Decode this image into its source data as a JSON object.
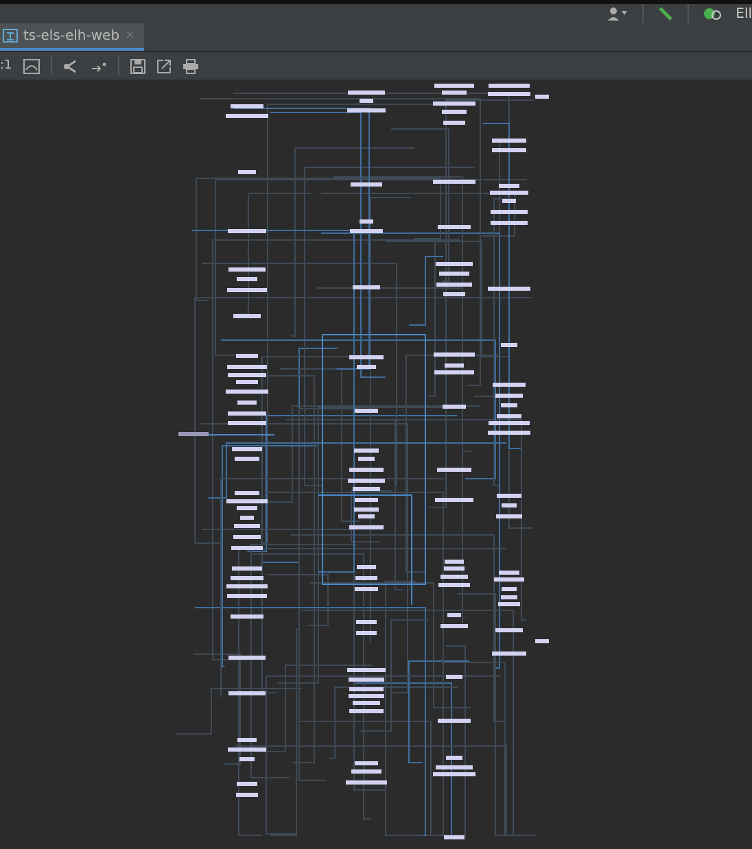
{
  "top_bar": {
    "run_config": "Ell"
  },
  "tabs": [
    {
      "label": "ts-els-elh-web",
      "selected": true,
      "close": "×"
    }
  ],
  "toolbar": {
    "zoom_label": ":1"
  },
  "diagram": {
    "kind": "picture"
  }
}
